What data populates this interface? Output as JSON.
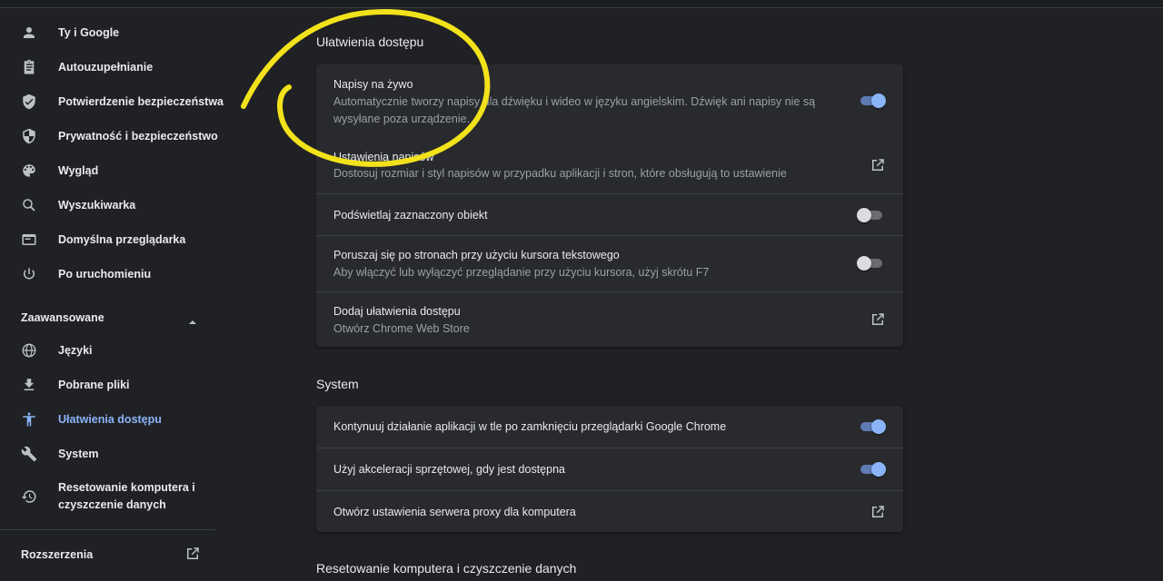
{
  "sidebar": {
    "items": [
      {
        "label": "Ty i Google",
        "icon": "person-icon"
      },
      {
        "label": "Autouzupełnianie",
        "icon": "clipboard-icon"
      },
      {
        "label": "Potwierdzenie bezpieczeństwa",
        "icon": "shield-check-icon"
      },
      {
        "label": "Prywatność i bezpieczeństwo",
        "icon": "shield-icon"
      },
      {
        "label": "Wygląd",
        "icon": "palette-icon"
      },
      {
        "label": "Wyszukiwarka",
        "icon": "search-icon"
      },
      {
        "label": "Domyślna przeglądarka",
        "icon": "browser-icon"
      },
      {
        "label": "Po uruchomieniu",
        "icon": "power-icon"
      }
    ],
    "advanced_label": "Zaawansowane",
    "advanced_items": [
      {
        "label": "Języki",
        "icon": "globe-icon"
      },
      {
        "label": "Pobrane pliki",
        "icon": "download-icon"
      },
      {
        "label": "Ułatwienia dostępu",
        "icon": "accessibility-icon",
        "active": true
      },
      {
        "label": "System",
        "icon": "wrench-icon"
      },
      {
        "label": "Resetowanie komputera i czyszczenie danych",
        "icon": "history-icon"
      }
    ],
    "extensions_label": "Rozszerzenia"
  },
  "accessibility": {
    "title": "Ułatwienia dostępu",
    "live_captions_title": "Napisy na żywo",
    "live_captions_desc": "Automatycznie tworzy napisy dla dźwięku i wideo w języku angielskim. Dźwięk ani napisy nie są wysyłane poza urządzenie.",
    "live_captions_on": true,
    "caption_settings_title": "Ustawienia napisów",
    "caption_settings_desc": "Dostosuj rozmiar i styl napisów w przypadku aplikacji i stron, które obsługują to ustawienie",
    "highlight_title": "Podświetlaj zaznaczony obiekt",
    "highlight_on": false,
    "caret_title": "Poruszaj się po stronach przy użyciu kursora tekstowego",
    "caret_desc": "Aby włączyć lub wyłączyć przeglądanie przy użyciu kursora, użyj skrótu F7",
    "caret_on": false,
    "add_title": "Dodaj ułatwienia dostępu",
    "add_desc": "Otwórz Chrome Web Store"
  },
  "system": {
    "title": "System",
    "background_apps": "Kontynuuj działanie aplikacji w tle po zamknięciu przeglądarki Google Chrome",
    "background_apps_on": true,
    "hw_accel": "Użyj akceleracji sprzętowej, gdy jest dostępna",
    "hw_accel_on": true,
    "proxy": "Otwórz ustawienia serwera proxy dla komputera"
  },
  "reset": {
    "title": "Resetowanie komputera i czyszczenie danych"
  },
  "colors": {
    "accent": "#8ab4f8",
    "annotation": "#f2e21b",
    "background": "#202124",
    "card": "#292a2d"
  }
}
